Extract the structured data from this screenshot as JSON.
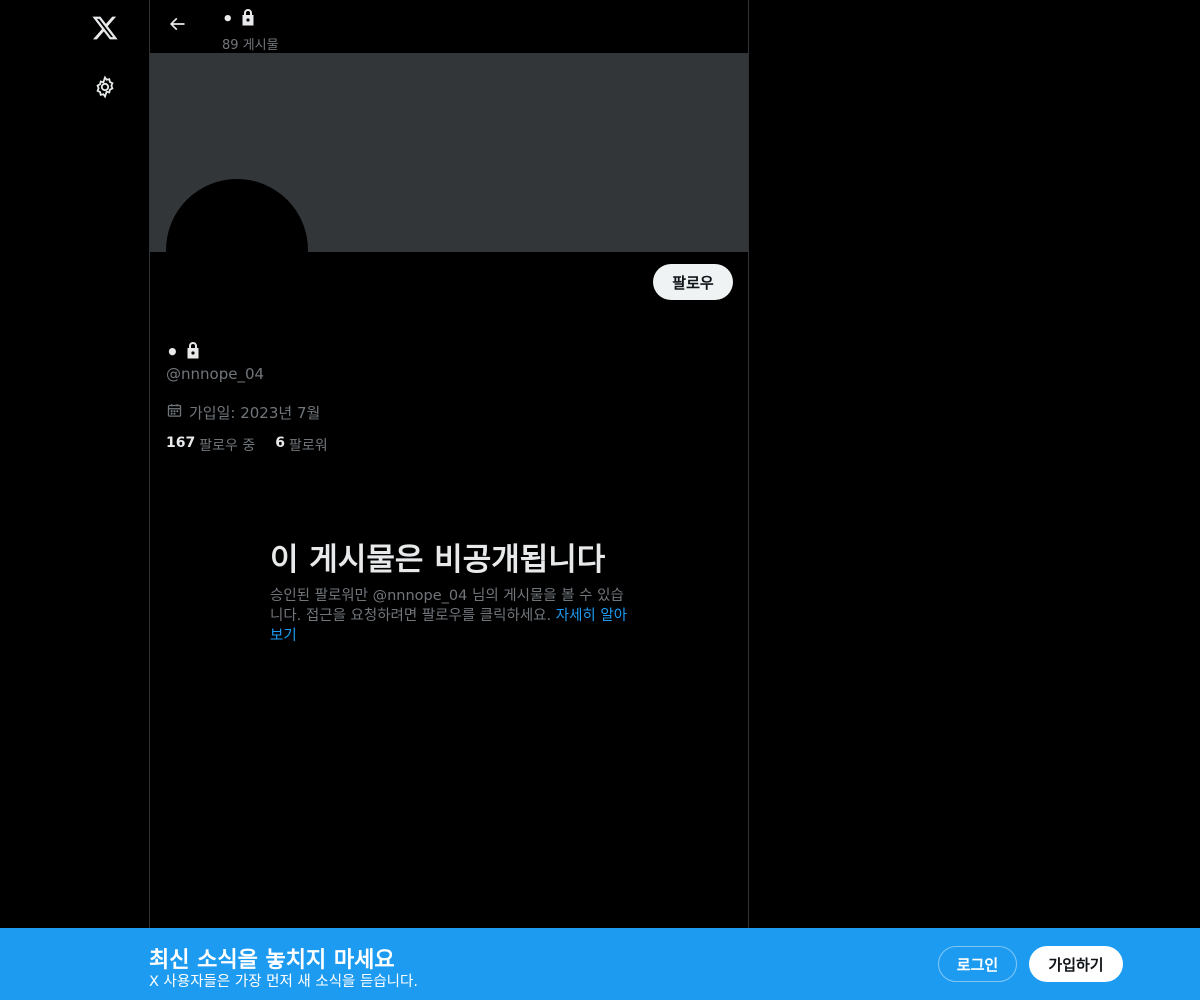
{
  "header": {
    "display_name": "•",
    "post_count": "89 게시물"
  },
  "profile": {
    "display_name": "•",
    "handle": "@nnnope_04",
    "joined": "가입일: 2023년 7월",
    "follow_label": "팔로우",
    "following_count": "167",
    "following_label": "팔로우 중",
    "followers_count": "6",
    "followers_label": "팔로워"
  },
  "private_notice": {
    "title": "이 게시물은 비공개됩니다",
    "description": "승인된 팔로워만 @nnnope_04 님의 게시물을 볼 수 있습니다. 접근을 요청하려면 팔로우를 클릭하세요. ",
    "learn_more": "자세히 알아보기"
  },
  "bottom_bar": {
    "title": "최신 소식을 놓치지 마세요",
    "subtitle": "X 사용자들은 가장 먼저 새 소식을 듣습니다.",
    "login_label": "로그인",
    "signup_label": "가입하기"
  },
  "icons": {
    "logo": "x-logo-icon",
    "settings": "gear-icon",
    "back": "arrow-left-icon",
    "lock": "lock-icon",
    "calendar": "calendar-icon"
  },
  "colors": {
    "accent": "#1d9bf0",
    "banner": "#333639",
    "muted_text": "#71767b"
  }
}
